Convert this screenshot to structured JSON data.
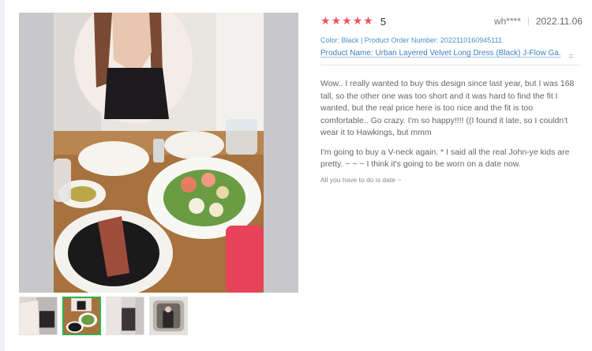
{
  "review": {
    "rating_stars": 5,
    "rating_value": "5",
    "reviewer": "wh****",
    "date": "2022.11.06",
    "order_info": "Color: Black | Product Order Number: 2022110160945111",
    "product_name": "Product Name: Urban Layered Velvet Long Dress (Black) J-Flow Ga.",
    "product_more": "..",
    "paragraphs": [
      "Wow.. I really wanted to buy this design since last year, but I was 168 tall, so the other one was too short and it was hard to find the fit I wanted, but the real price here is too nice and the fit is too comfortable.. Go crazy. I'm so happy!!!! ((I found it late, so I couldn't wear it to Hawkings, but mmm",
      "I'm going to buy a V-neck again. * I said all the real John-ye kids are pretty. ~ ~ ~ I think it's going to be worn on a date now."
    ],
    "footnote": "All you have to do is date ~"
  },
  "gallery": {
    "active_index": 1,
    "thumbnails": [
      "thumb-1",
      "thumb-2",
      "thumb-3",
      "thumb-4"
    ]
  },
  "colors": {
    "star": "#f2515e",
    "link": "#3f7fc2",
    "active_thumb_border": "#2fb34a"
  },
  "icons": {
    "star": "star-icon"
  }
}
